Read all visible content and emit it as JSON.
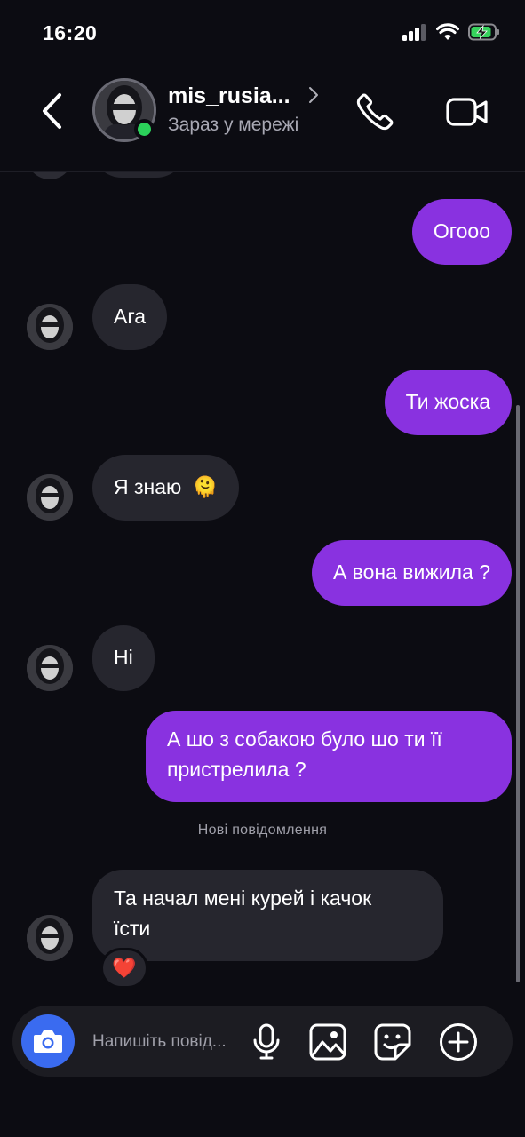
{
  "status_bar": {
    "time": "16:20"
  },
  "header": {
    "username": "mis_rusia...",
    "status": "Зараз у мережі"
  },
  "messages": [
    {
      "id": 0,
      "direction": "outgoing",
      "text": "Огооо"
    },
    {
      "id": 1,
      "direction": "incoming",
      "text": "Ага"
    },
    {
      "id": 2,
      "direction": "outgoing",
      "text": "Ти жоска"
    },
    {
      "id": 3,
      "direction": "incoming",
      "text": "Я знаю",
      "emoji": "🫠"
    },
    {
      "id": 4,
      "direction": "outgoing",
      "text": "А вона вижила ?"
    },
    {
      "id": 5,
      "direction": "incoming",
      "text": "Ні"
    },
    {
      "id": 6,
      "direction": "outgoing",
      "line1": "А шо з собакою було шо ти її",
      "line2": "пристрелила ?"
    },
    {
      "id": 7,
      "direction": "incoming",
      "line1": "Та начал мені курей і качок",
      "line2": "їсти",
      "reaction": "❤️"
    }
  ],
  "divider": {
    "label": "Нові повідомлення"
  },
  "composer": {
    "placeholder": "Напишіть повід..."
  },
  "colors": {
    "background": "#0c0c12",
    "outgoing_bubble": "#8932e0",
    "incoming_bubble": "#26262e",
    "online": "#2bd15a",
    "camera_button": "#3a6bf0"
  },
  "icons": {
    "back": "chevron-left-icon",
    "profile_chevron": "chevron-right-icon",
    "call": "phone-icon",
    "video": "video-camera-icon",
    "camera": "camera-icon",
    "mic": "microphone-icon",
    "gallery": "image-icon",
    "sticker": "sticker-icon",
    "add": "plus-circle-icon"
  }
}
